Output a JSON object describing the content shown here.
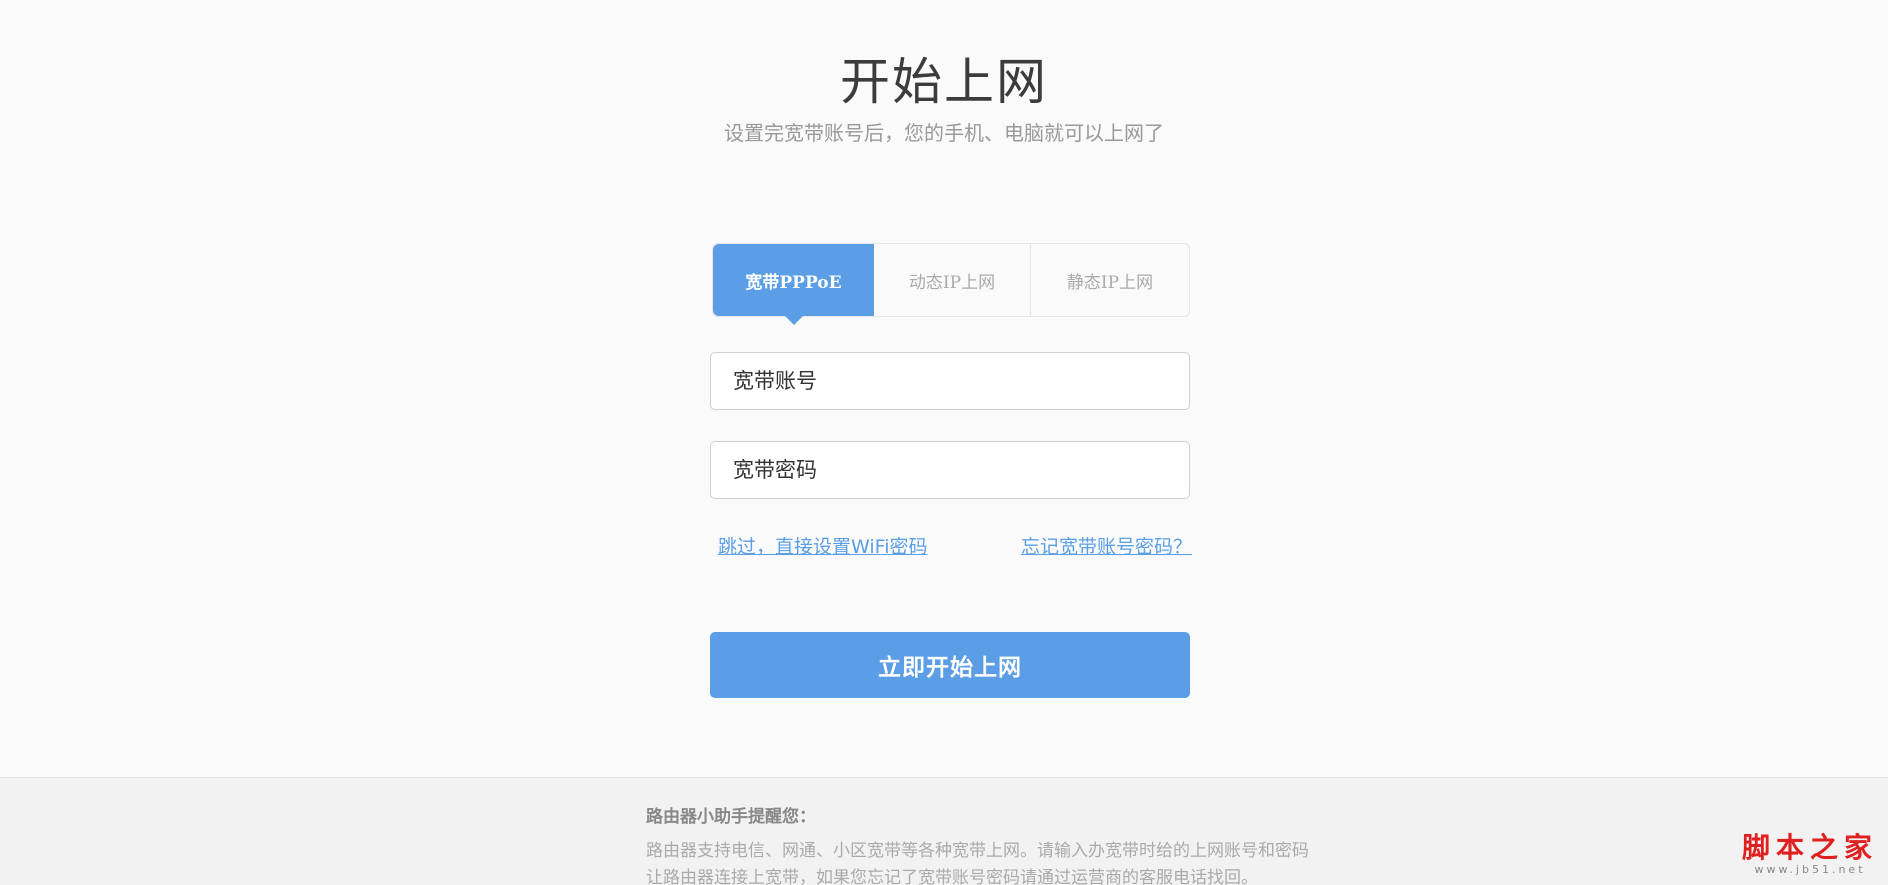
{
  "header": {
    "title": "开始上网",
    "subtitle": "设置完宽带账号后，您的手机、电脑就可以上网了"
  },
  "tabs": [
    {
      "label": "宽带PPPoE",
      "active": true
    },
    {
      "label": "动态IP上网",
      "active": false
    },
    {
      "label": "静态IP上网",
      "active": false
    }
  ],
  "form": {
    "account_placeholder": "宽带账号",
    "password_placeholder": "宽带密码",
    "skip_link": "跳过，直接设置WiFi密码",
    "forgot_link": "忘记宽带账号密码？",
    "submit_label": "立即开始上网"
  },
  "footer": {
    "title": "路由器小助手提醒您：",
    "line1": "路由器支持电信、网通、小区宽带等各种宽带上网。请输入办宽带时给的上网账号和密码",
    "line2": "让路由器连接上宽带，如果您忘记了宽带账号密码请通过运营商的客服电话找回。"
  },
  "watermark": {
    "brand": "脚本之家",
    "url": "www.jb51.net"
  },
  "colors": {
    "accent": "#5b9ee5",
    "background": "#fafafa",
    "watermark": "#e02020"
  }
}
